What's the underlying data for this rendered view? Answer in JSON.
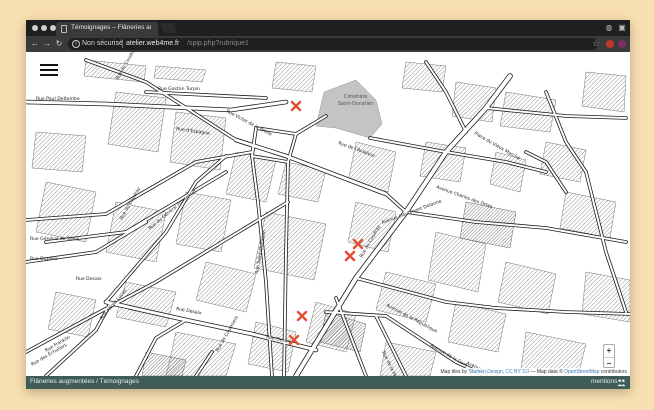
{
  "browser": {
    "tab_title": "Témoignages – Flâneries augmentées",
    "security_label": "Non sécurisé",
    "url_host": "atelier.web4me.fr",
    "url_path": "/spip.php?rubrique1",
    "ext_colors": [
      "#c0392b",
      "#7d2f66"
    ]
  },
  "map": {
    "menu_icon": "hamburger-icon",
    "marker_color": "#e0533a",
    "cemetery_label_1": "Cimetière",
    "cemetery_label_2": "Saint-Donatien",
    "streets": {
      "rue_paul_deltombe": "Rue Paul Deltombe",
      "rue_gaston_turpin": "Rue Gaston Turpin",
      "rue_victor_de_la_brelle": "Rue Victor de la Brelle",
      "rue_du_coudray_1": "Rue du Coudray",
      "rue_du_coudray_2": "Rue du Coudray",
      "rue_d_espagne": "Rue d'Espagne",
      "rue_du_general_fromentin": "Rue du Général Fromentin",
      "rue_general_de_sonis": "Rue Général de Sonis",
      "rue_dupleix": "Rue Dupleix",
      "rue_saint_donatien": "Rue Saint-Donatien",
      "rue_desaix_1": "Rue Desaix",
      "rue_desaix_2": "Rue Desaix",
      "rue_desaix_3": "Rue Desaix",
      "rue_alfred_lucas": "Rue Alfred Lucas",
      "rue_franklin": "Rue Franklin",
      "rue_des_echoliers": "Rue des Écholiers",
      "rue_de_l_aviateur": "Rue de l'Aviateur",
      "rue_de_coulmiers": "Rue de Coulmiers",
      "avenue_de_la_republique": "Avenue de la République",
      "rue_du_coudray_3": "Rue du Coudray",
      "place_du_vieux_marche": "Place du Vieux Marché",
      "avenue_lieutenant_delanne": "Avenue Lieutenant Delanne",
      "avenue_des_orties": "Avenue Charles des Ortes",
      "avenue_de_la_gare": "Avenue de la Gare",
      "avenue_de_la_paix": "Avenue de la Paix",
      "rue_des_montagne": "Rue de la Montagne"
    },
    "attribution": {
      "prefix": "Map tiles by",
      "stamen": "Stamen Design",
      "comma": ",",
      "license": "CC BY 3.0",
      "middle": "— Map data ©",
      "osm": "OpenStreetMap",
      "suffix": "contributors"
    },
    "zoom_in": "+",
    "zoom_out": "−"
  },
  "footer": {
    "breadcrumb": "Flâneries augmentées / Témoignages",
    "mentions": "mentions",
    "icon": "people-icon"
  }
}
